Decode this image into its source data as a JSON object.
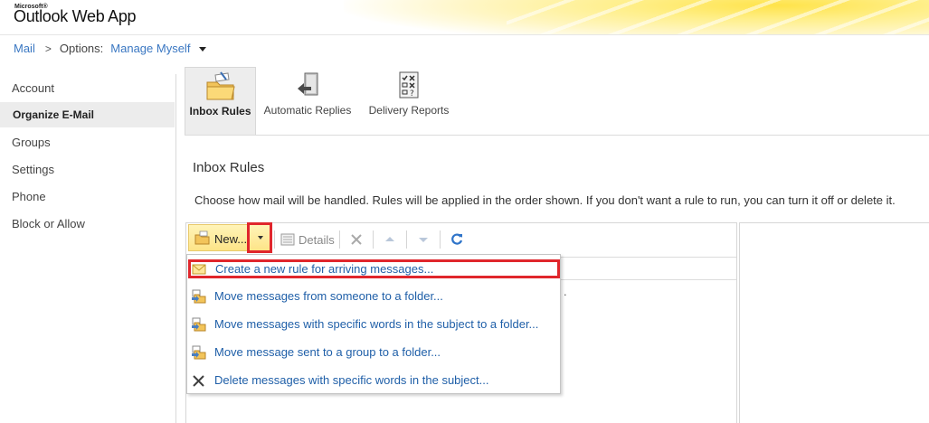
{
  "header": {
    "brand_small": "Microsoft®",
    "app_title": "Outlook Web App"
  },
  "breadcrumb": {
    "mail": "Mail",
    "separator": ">",
    "options_label": "Options:",
    "current": "Manage Myself"
  },
  "sidebar": {
    "items": [
      {
        "label": "Account"
      },
      {
        "label": "Organize E-Mail"
      },
      {
        "label": "Groups"
      },
      {
        "label": "Settings"
      },
      {
        "label": "Phone"
      },
      {
        "label": "Block or Allow"
      }
    ],
    "selected": "Organize E-Mail"
  },
  "iconbar": {
    "inbox_rules": "Inbox Rules",
    "automatic_replies": "Automatic Replies",
    "delivery_reports": "Delivery Reports"
  },
  "main": {
    "title": "Inbox Rules",
    "description": "Choose how mail will be handled. Rules will be applied in the order shown. If you don't want a rule to run, you can turn it off or delete it.",
    "partial_text": "."
  },
  "toolbar": {
    "new_label": "New...",
    "details_label": "Details"
  },
  "menu": {
    "items": [
      {
        "label": "Create a new rule for arriving messages...",
        "icon": "envelope-icon"
      },
      {
        "label": "Move messages from someone to a folder...",
        "icon": "move-folder-icon"
      },
      {
        "label": "Move messages with specific words in the subject to a folder...",
        "icon": "move-folder-icon"
      },
      {
        "label": "Move message sent to a group to a folder...",
        "icon": "move-folder-icon"
      },
      {
        "label": "Delete messages with specific words in the subject...",
        "icon": "delete-x-icon"
      }
    ]
  },
  "colors": {
    "link": "#3a77c2",
    "highlight_border": "#e0262c",
    "new_button": "#fde488",
    "selected_bg": "#ececec"
  }
}
